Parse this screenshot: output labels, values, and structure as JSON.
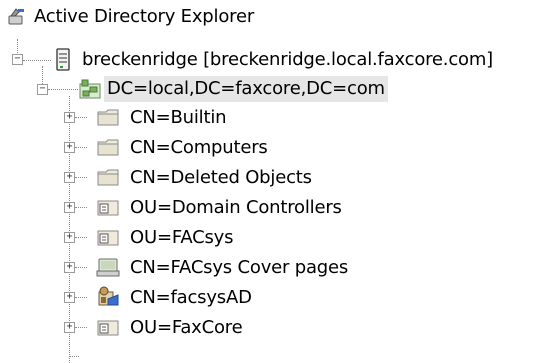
{
  "tree": {
    "root": {
      "label": "Active Directory Explorer",
      "icon": "ad-explorer-icon"
    },
    "server": {
      "label": "breckenridge [breckenridge.local.faxcore.com]",
      "icon": "server-icon",
      "expanded": true
    },
    "domain": {
      "label": "DC=local,DC=faxcore,DC=com",
      "icon": "domain-icon",
      "expanded": true,
      "selected": true
    },
    "children": [
      {
        "label": "CN=Builtin",
        "icon": "folder-icon",
        "expanded": false
      },
      {
        "label": "CN=Computers",
        "icon": "folder-icon",
        "expanded": false
      },
      {
        "label": "CN=Deleted Objects",
        "icon": "folder-icon",
        "expanded": false
      },
      {
        "label": "OU=Domain Controllers",
        "icon": "ou-icon",
        "expanded": false
      },
      {
        "label": "OU=FACsys",
        "icon": "ou-icon",
        "expanded": false
      },
      {
        "label": "CN=FACsys Cover pages",
        "icon": "container-icon",
        "expanded": false
      },
      {
        "label": "CN=facsysAD",
        "icon": "facsys-ad-icon",
        "expanded": false
      },
      {
        "label": "OU=FaxCore",
        "icon": "ou-icon",
        "expanded": false
      }
    ]
  },
  "colors": {
    "selection": "#e6e6e6",
    "tree_lines": "#8a8a8a",
    "folder": "#e8e3d0"
  }
}
